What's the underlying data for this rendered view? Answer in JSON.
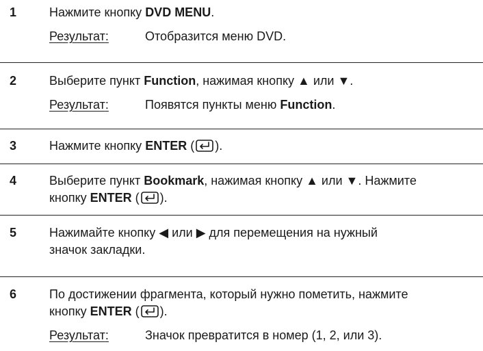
{
  "steps": [
    {
      "number": "1",
      "lines": [
        [
          {
            "t": "Нажмите кнопку "
          },
          {
            "t": "DVD MENU",
            "b": true
          },
          {
            "t": "."
          }
        ]
      ],
      "result_label": "Результат",
      "result_sep": ":",
      "result": [
        {
          "t": "Отобразится меню DVD."
        }
      ]
    },
    {
      "number": "2",
      "lines": [
        [
          {
            "t": "Выберите пункт "
          },
          {
            "t": "Function",
            "b": true
          },
          {
            "t": ", нажимая кнопку ▲ или ▼."
          }
        ]
      ],
      "result_label": "Результат",
      "result_sep": ":",
      "result": [
        {
          "t": "Появятся пункты меню "
        },
        {
          "t": "Function",
          "b": true
        },
        {
          "t": "."
        }
      ]
    },
    {
      "number": "3",
      "lines": [
        [
          {
            "t": "Нажмите кнопку "
          },
          {
            "t": "ENTER",
            "b": true
          },
          {
            "t": " ("
          },
          {
            "icon": "enter-key-icon"
          },
          {
            "t": ")."
          }
        ]
      ]
    },
    {
      "number": "4",
      "lines": [
        [
          {
            "t": "Выберите пункт "
          },
          {
            "t": "Bookmark",
            "b": true
          },
          {
            "t": ", нажимая кнопку ▲ или ▼. Нажмите"
          }
        ],
        [
          {
            "t": "кнопку "
          },
          {
            "t": "ENTER",
            "b": true
          },
          {
            "t": " ("
          },
          {
            "icon": "enter-key-icon"
          },
          {
            "t": ")."
          }
        ]
      ]
    },
    {
      "number": "5",
      "lines": [
        [
          {
            "t": "Нажимайте кнопку ◀ или ▶ для перемещения на нужный"
          }
        ],
        [
          {
            "t": "значок закладки."
          }
        ]
      ]
    },
    {
      "number": "6",
      "lines": [
        [
          {
            "t": "По достижении фрагмента, который нужно пометить, нажмите"
          }
        ],
        [
          {
            "t": "кнопку "
          },
          {
            "t": "ENTER",
            "b": true
          },
          {
            "t": " ("
          },
          {
            "icon": "enter-key-icon"
          },
          {
            "t": ")."
          }
        ]
      ],
      "result_label": "Результат",
      "result_sep": ":",
      "result": [
        {
          "t": "Значок превратится в номер (1, 2, или 3)."
        }
      ]
    }
  ]
}
